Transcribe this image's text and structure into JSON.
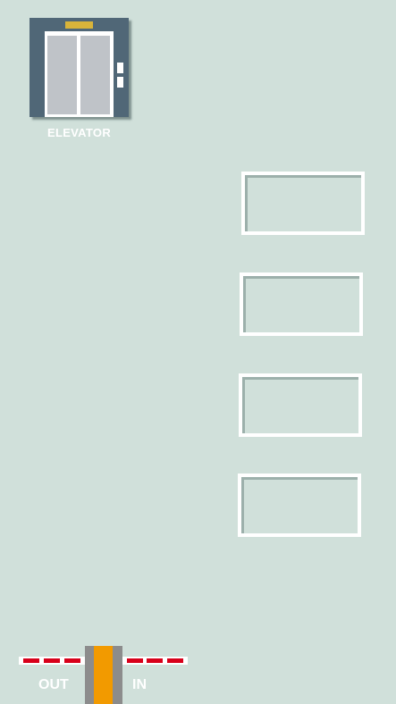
{
  "elevator": {
    "label": "ELEVATOR"
  },
  "parking": {
    "slots": [
      {
        "label": ""
      },
      {
        "label": ""
      },
      {
        "label": ""
      },
      {
        "label": ""
      }
    ]
  },
  "gate": {
    "out_label": "OUT",
    "in_label": "IN"
  },
  "colors": {
    "background": "#d0e0da",
    "elevator_body": "#506777",
    "elevator_indicator": "#d9b43a",
    "barrier_stripe": "#d8001a",
    "gate_post_core": "#f29a00",
    "gate_post": "#8c8c8c"
  }
}
